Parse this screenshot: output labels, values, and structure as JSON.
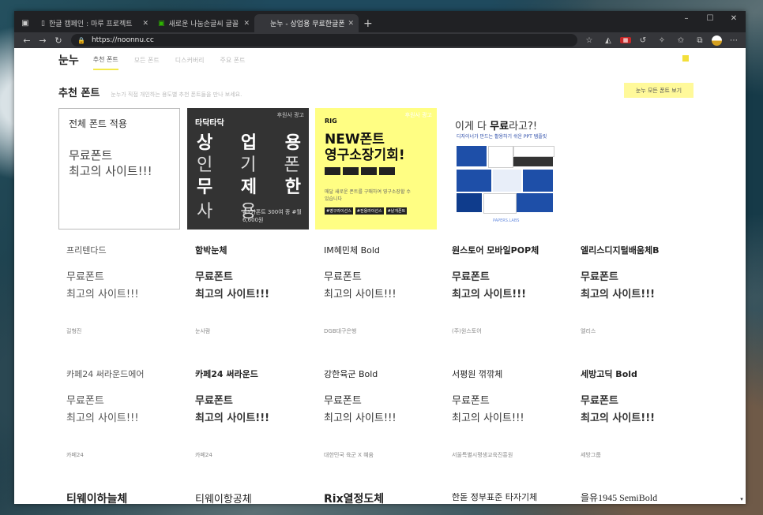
{
  "browser": {
    "tabs": [
      {
        "title": "한글 캠페인 : 마루 프로젝트",
        "close": "✕"
      },
      {
        "title": "새로운 나눔손글씨 글꼴 - 네이버",
        "close": "✕"
      },
      {
        "title": "눈누 - 상업용 무료한글폰트 사이트",
        "close": "✕"
      }
    ],
    "new_tab": "+",
    "url": "https://noonnu.cc",
    "window_controls": [
      "–",
      "☐",
      "✕"
    ]
  },
  "site": {
    "logo": "눈누",
    "menu": [
      "추천 폰트",
      "모든 폰트",
      "디스커버리",
      "주요 폰트"
    ],
    "section_title": "추천 폰트",
    "section_sub": "눈누가 직접 개인하는 용도별 추천 폰트들을 만나 보세요.",
    "all_fonts_button": "눈누 모든 폰트 보기"
  },
  "featured": {
    "card1": {
      "title": "전체 폰트 적용",
      "line1": "무료폰트",
      "line2": "최고의 사이트!!!"
    },
    "card2": {
      "sponsor": "후원사 광고",
      "head": "타닥타닥",
      "rows": [
        "상 업 용",
        "인 기 폰 트",
        "무 제 한",
        "사 용"
      ],
      "price": "#1가폰트 300여 종 #월6,600원"
    },
    "card3": {
      "sponsor": "후원사 광고",
      "brand": "RIG",
      "line1": "NEW폰트",
      "line2": "영구소장기회!",
      "desc": "매달 새로운 폰트를 구매하여 영구소장할 수 있습니다",
      "tags": [
        "#영구라이선스",
        "#전용라이선스",
        "#낱개폰트"
      ]
    },
    "card4": {
      "title_pre": "이게 다 ",
      "title_bold": "무료",
      "title_post": "라고?!",
      "sub": "디자이너가 만드는 활용하기 쉬운 PPT 템플릿",
      "footer": "PAPERS.LABS"
    }
  },
  "font_rows": [
    [
      {
        "name": "프리텐다드",
        "p1": "무료폰트",
        "p2": "최고의 사이트!!!",
        "maker": "길형진"
      },
      {
        "name": "함박눈체",
        "p1": "무료폰트",
        "p2": "최고의 사이트!!!",
        "maker": "눈사람"
      },
      {
        "name": "IM혜민체 Bold",
        "p1": "무료폰트",
        "p2": "최고의 사이트!!!",
        "maker": "DGB대구은행"
      },
      {
        "name": "원스토어 모바일POP체",
        "p1": "무료폰트",
        "p2": "최고의 사이트!!!",
        "maker": "(주)원스토어"
      },
      {
        "name": "엘리스디지털배움체B",
        "p1": "무료폰트",
        "p2": "최고의 사이트!!!",
        "maker": "엘리스"
      }
    ],
    [
      {
        "name": "카페24 써라운드에어",
        "p1": "무료폰트",
        "p2": "최고의 사이트!!!",
        "maker": "카페24"
      },
      {
        "name": "카페24 써라운드",
        "p1": "무료폰트",
        "p2": "최고의 사이트!!!",
        "maker": "카페24"
      },
      {
        "name": "강한육군 Bold",
        "p1": "무료폰트",
        "p2": "최고의 사이트!!!",
        "maker": "대한민국 육군 X 혜움"
      },
      {
        "name": "서평원 꺾깎체",
        "p1": "무료폰트",
        "p2": "최고의 사이트!!!",
        "maker": "서울특별시평생교육진흥원"
      },
      {
        "name": "세방고딕 Bold",
        "p1": "무료폰트",
        "p2": "최고의 사이트!!!",
        "maker": "세방그룹"
      }
    ],
    [
      {
        "name": "티웨이하늘체",
        "p1": "",
        "p2": "",
        "maker": ""
      },
      {
        "name": "티웨이항공체",
        "p1": "",
        "p2": "",
        "maker": ""
      },
      {
        "name": "Rix열정도체",
        "p1": "",
        "p2": "",
        "maker": ""
      },
      {
        "name": "한돋 정부표준 타자기체",
        "p1": "",
        "p2": "",
        "maker": ""
      },
      {
        "name": "을유1945 SemiBold",
        "p1": "",
        "p2": "",
        "maker": ""
      }
    ]
  ]
}
